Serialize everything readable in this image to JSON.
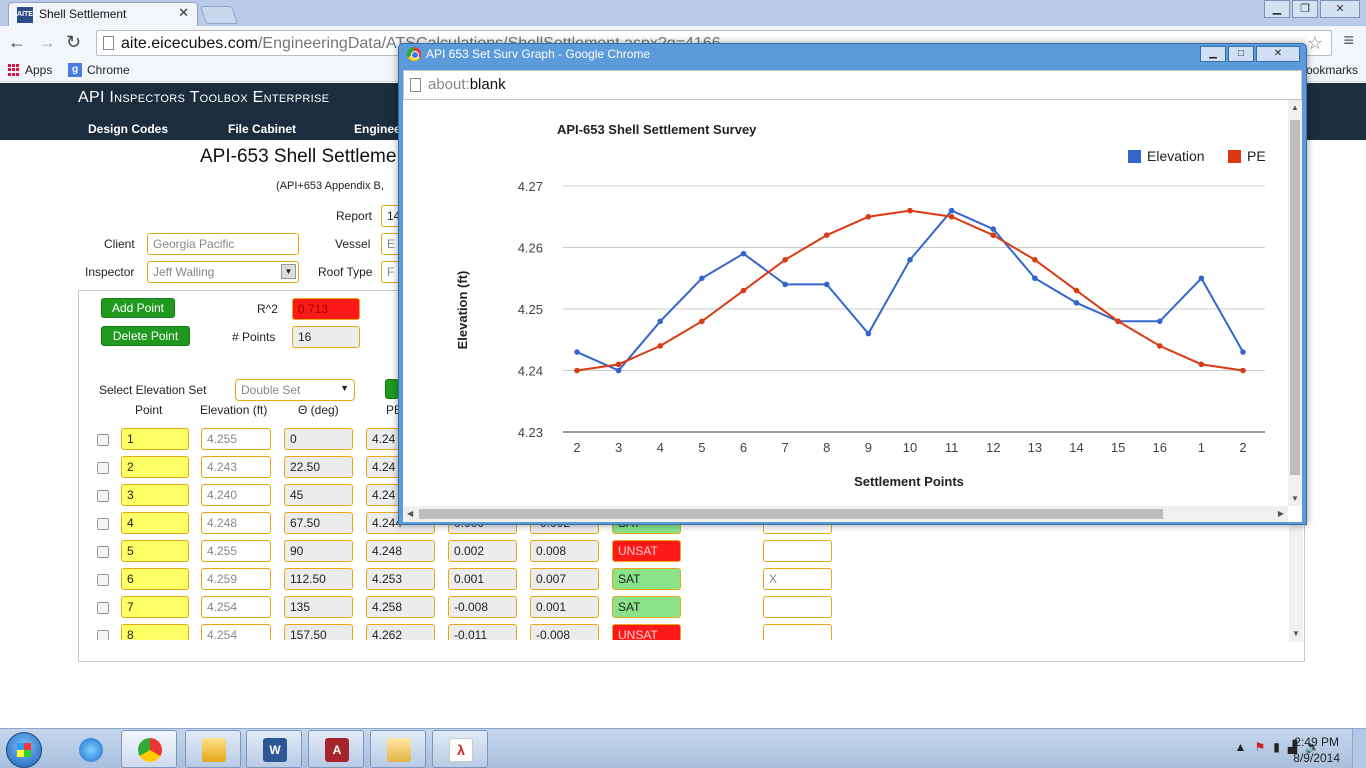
{
  "browser": {
    "tab_title": "Shell Settlement",
    "favicon_text": "AITE",
    "url_host": "aite.eicecubes.com",
    "url_path": "/EngineeringData/ATSCalculations/ShellSettlement.aspx?q=4166",
    "bookmarks": {
      "apps": "Apps",
      "chrome": "Chrome",
      "other": "ookmarks"
    }
  },
  "site": {
    "title": "API Inspectors Toolbox Enterprise",
    "nav": [
      "Design Codes",
      "File Cabinet",
      "Enginee"
    ]
  },
  "page": {
    "title": "API-653 Shell Settleme",
    "subtitle": "(API+653 Appendix B,",
    "report_label": "Report",
    "report_value": "14",
    "client_label": "Client",
    "client_value": "Georgia Pacific",
    "vessel_label": "Vessel",
    "vessel_value": "E",
    "inspector_label": "Inspector",
    "inspector_value": "Jeff Walling",
    "roof_label": "Roof Type",
    "roof_value": "F",
    "add_point": "Add Point",
    "delete_point": "Delete Point",
    "r2_label": "R^2",
    "r2_value": "0.713",
    "npoints_label": "# Points",
    "npoints_value": "16",
    "elevset_label": "Select Elevation Set",
    "elevset_value": "Double Set",
    "col_point": "Point",
    "col_elev": "Elevation (ft)",
    "col_theta": "Θ (deg)",
    "col_pe": "PE",
    "rows": [
      {
        "point": "1",
        "elev": "4.255",
        "theta": "0",
        "pe": "4.24",
        "a": "",
        "b": "",
        "status": "",
        "x": ""
      },
      {
        "point": "2",
        "elev": "4.243",
        "theta": "22.50",
        "pe": "4.24",
        "a": "",
        "b": "",
        "status": "",
        "x": ""
      },
      {
        "point": "3",
        "elev": "4.240",
        "theta": "45",
        "pe": "4.24",
        "a": "",
        "b": "",
        "status": "",
        "x": ""
      },
      {
        "point": "4",
        "elev": "4.248",
        "theta": "67.50",
        "pe": "4.244",
        "a": "0.000",
        "b": "-0.002",
        "status": "SAT",
        "x": ""
      },
      {
        "point": "5",
        "elev": "4.255",
        "theta": "90",
        "pe": "4.248",
        "a": "0.002",
        "b": "0.008",
        "status": "UNSAT",
        "x": ""
      },
      {
        "point": "6",
        "elev": "4.259",
        "theta": "112.50",
        "pe": "4.253",
        "a": "0.001",
        "b": "0.007",
        "status": "SAT",
        "x": "X"
      },
      {
        "point": "7",
        "elev": "4.254",
        "theta": "135",
        "pe": "4.258",
        "a": "-0.008",
        "b": "0.001",
        "status": "SAT",
        "x": ""
      },
      {
        "point": "8",
        "elev": "4.254",
        "theta": "157.50",
        "pe": "4.262",
        "a": "-0.011",
        "b": "-0.008",
        "status": "UNSAT",
        "x": ""
      }
    ]
  },
  "popup": {
    "window_title": "API 653 Set Surv Graph - Google Chrome",
    "url_scheme": "about:",
    "url_rest": "blank"
  },
  "chart_data": {
    "type": "line",
    "title": "API-653 Shell Settlement Survey",
    "xlabel": "Settlement Points",
    "ylabel": "Elevation (ft)",
    "categories": [
      "2",
      "3",
      "4",
      "5",
      "6",
      "7",
      "8",
      "9",
      "10",
      "11",
      "12",
      "13",
      "14",
      "15",
      "16",
      "1",
      "2"
    ],
    "series": [
      {
        "name": "Elevation",
        "color": "#3366cc",
        "values": [
          4.243,
          4.24,
          4.248,
          4.255,
          4.259,
          4.254,
          4.254,
          4.246,
          4.258,
          4.266,
          4.263,
          4.255,
          4.251,
          4.248,
          4.248,
          4.255,
          4.243
        ]
      },
      {
        "name": "PE",
        "color": "#dc3912",
        "values": [
          4.24,
          4.241,
          4.244,
          4.248,
          4.253,
          4.258,
          4.262,
          4.265,
          4.266,
          4.265,
          4.262,
          4.258,
          4.253,
          4.248,
          4.244,
          4.241,
          4.24
        ]
      }
    ],
    "yticks": [
      "4.23",
      "4.24",
      "4.25",
      "4.26",
      "4.27"
    ],
    "ylim": [
      4.23,
      4.27
    ],
    "grid": true,
    "legend": "top-right"
  },
  "taskbar": {
    "time": "2:49 PM",
    "date": "8/9/2014",
    "tray_arrow": "▲"
  }
}
